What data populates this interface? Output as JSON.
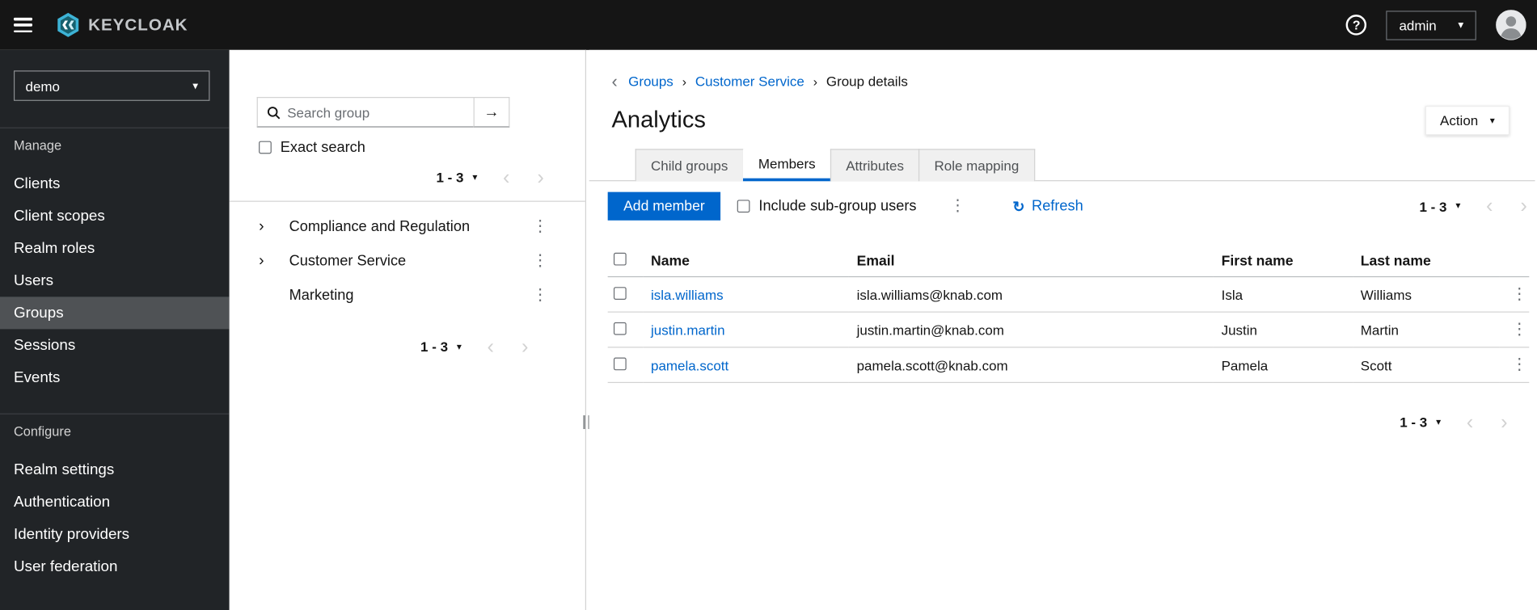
{
  "icons": {
    "help": "?",
    "caret_down": "▾",
    "chevron_left": "‹",
    "chevron_right": "›",
    "kebab": "⋮",
    "arrow_right": "→",
    "refresh": "↻",
    "back": "‹",
    "breadcrumb_sep": "›"
  },
  "topbar": {
    "brand": "KEYCLOAK",
    "user": "admin"
  },
  "sidebar": {
    "realm": "demo",
    "selected_item": "Groups",
    "manage": {
      "label": "Manage",
      "items": [
        "Clients",
        "Client scopes",
        "Realm roles",
        "Users",
        "Groups",
        "Sessions",
        "Events"
      ]
    },
    "configure": {
      "label": "Configure",
      "items": [
        "Realm settings",
        "Authentication",
        "Identity providers",
        "User federation"
      ]
    }
  },
  "tree": {
    "search_placeholder": "Search group",
    "exact_search": "Exact search",
    "pagination_top": "1 - 3",
    "pagination_bottom": "1 - 3",
    "groups": [
      {
        "name": "Compliance and Regulation",
        "expandable": true
      },
      {
        "name": "Customer Service",
        "expandable": true
      },
      {
        "name": "Marketing",
        "expandable": false
      }
    ]
  },
  "main": {
    "breadcrumb": {
      "items": [
        "Groups",
        "Customer Service",
        "Group details"
      ]
    },
    "title": "Analytics",
    "action": "Action",
    "tabs": [
      "Child groups",
      "Members",
      "Attributes",
      "Role mapping"
    ],
    "active_tab": "Members",
    "toolbar": {
      "add_member": "Add member",
      "include_subgroups": "Include sub-group users",
      "refresh": "Refresh",
      "pagination": "1 - 3"
    },
    "table": {
      "headers": {
        "name": "Name",
        "email": "Email",
        "first": "First name",
        "last": "Last name"
      },
      "rows": [
        {
          "name": "isla.williams",
          "email": "isla.williams@knab.com",
          "first": "Isla",
          "last": "Williams"
        },
        {
          "name": "justin.martin",
          "email": "justin.martin@knab.com",
          "first": "Justin",
          "last": "Martin"
        },
        {
          "name": "pamela.scott",
          "email": "pamela.scott@knab.com",
          "first": "Pamela",
          "last": "Scott"
        }
      ]
    },
    "pagination_bottom": "1 - 3"
  },
  "colors": {
    "accent": "#0066cc",
    "topbar_bg": "#151515",
    "sidebar_bg": "#212427",
    "selected_nav_bg": "#4f5255"
  }
}
